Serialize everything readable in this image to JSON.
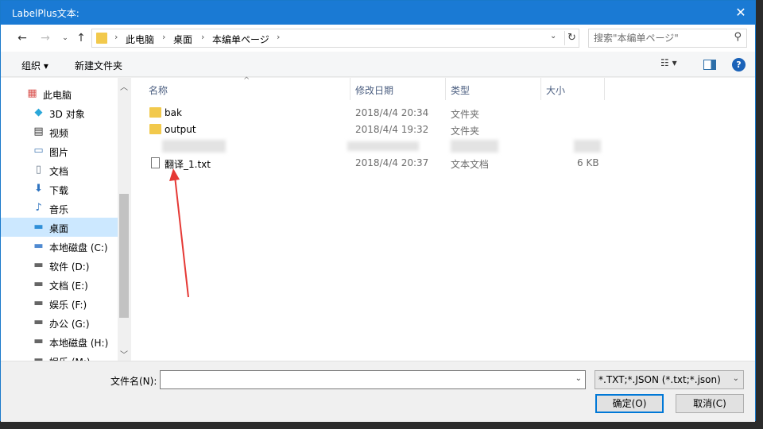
{
  "window": {
    "title": "LabelPlus文本:",
    "close_glyph": "✕"
  },
  "address": {
    "crumbs": [
      "此电脑",
      "桌面",
      "本编单ページ"
    ],
    "search_placeholder": "搜索\"本编单ページ\""
  },
  "toolbar": {
    "organize": "组织 ▾",
    "new_folder": "新建文件夹",
    "help": "?"
  },
  "nav": {
    "items": [
      {
        "label": "此电脑",
        "icon": "pc-icon",
        "glyph": "▦",
        "color": "#d9534f"
      },
      {
        "label": "3D 对象",
        "icon": "cube-icon",
        "glyph": "◆",
        "color": "#2aa7d9"
      },
      {
        "label": "视频",
        "icon": "video-icon",
        "glyph": "▤",
        "color": "#333"
      },
      {
        "label": "图片",
        "icon": "picture-icon",
        "glyph": "▭",
        "color": "#4a7db5"
      },
      {
        "label": "文档",
        "icon": "document-icon",
        "glyph": "▯",
        "color": "#6b7b8c"
      },
      {
        "label": "下载",
        "icon": "download-icon",
        "glyph": "⬇",
        "color": "#2f74c0"
      },
      {
        "label": "音乐",
        "icon": "music-icon",
        "glyph": "♪",
        "color": "#2f74c0"
      },
      {
        "label": "桌面",
        "icon": "desktop-icon",
        "glyph": "▬",
        "color": "#2f8fd8"
      },
      {
        "label": "本地磁盘 (C:)",
        "icon": "drive-icon",
        "glyph": "▬",
        "color": "#4f8ad1"
      },
      {
        "label": "软件 (D:)",
        "icon": "drive-icon",
        "glyph": "▬",
        "color": "#666"
      },
      {
        "label": "文档 (E:)",
        "icon": "drive-icon",
        "glyph": "▬",
        "color": "#666"
      },
      {
        "label": "娱乐 (F:)",
        "icon": "drive-icon",
        "glyph": "▬",
        "color": "#666"
      },
      {
        "label": "办公 (G:)",
        "icon": "drive-icon",
        "glyph": "▬",
        "color": "#666"
      },
      {
        "label": "本地磁盘 (H:)",
        "icon": "drive-icon",
        "glyph": "▬",
        "color": "#666"
      },
      {
        "label": "娱乐 (M:)",
        "icon": "drive-icon",
        "glyph": "▬",
        "color": "#666"
      }
    ],
    "selected_index": 7
  },
  "columns": {
    "name": "名称",
    "date": "修改日期",
    "type": "类型",
    "size": "大小"
  },
  "files": [
    {
      "name": "bak",
      "date": "2018/4/4 20:34",
      "type": "文件夹",
      "size": "",
      "kind": "folder"
    },
    {
      "name": "output",
      "date": "2018/4/4 19:32",
      "type": "文件夹",
      "size": "",
      "kind": "folder"
    },
    {
      "name": "翻译_1.txt",
      "date": "2018/4/4 20:37",
      "type": "文本文档",
      "size": "6 KB",
      "kind": "doc"
    }
  ],
  "bottom": {
    "filename_label": "文件名(N):",
    "filename_value": "",
    "filetype": "*.TXT;*.JSON (*.txt;*.json)",
    "ok": "确定(O)",
    "cancel": "取消(C)"
  }
}
